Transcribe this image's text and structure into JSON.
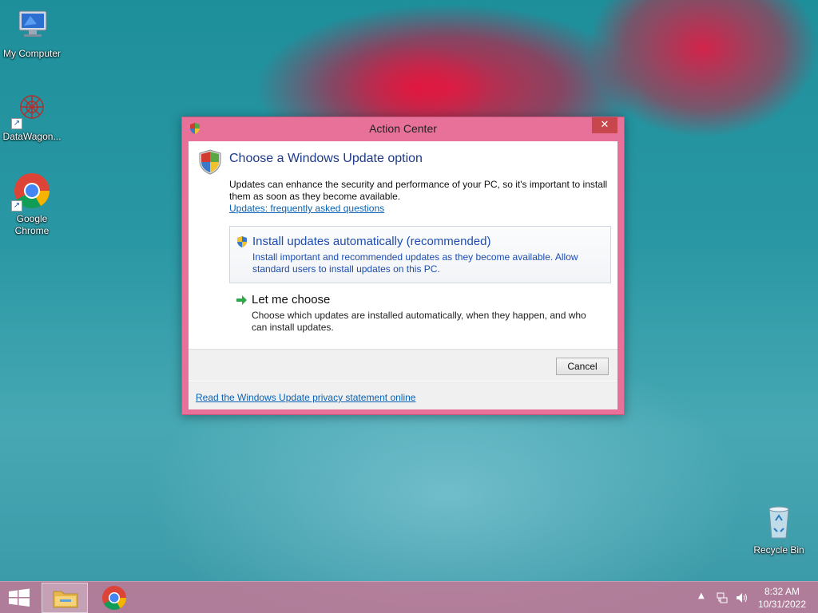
{
  "desktop": {
    "icons": [
      {
        "label": "My Computer"
      },
      {
        "label": "DataWagon..."
      },
      {
        "label": "Google Chrome"
      },
      {
        "label": "Recycle Bin"
      }
    ]
  },
  "dialog": {
    "title": "Action Center",
    "close_label": "✕",
    "heading": "Choose a Windows Update option",
    "description": "Updates can enhance the security and performance of your PC, so it's important to install them as soon as they become available.",
    "faq_link": "Updates: frequently asked questions",
    "options": [
      {
        "title": "Install updates automatically (recommended)",
        "description": "Install important and recommended updates as they become available. Allow standard users to install updates on this PC.",
        "icon": "shield-icon"
      },
      {
        "title": "Let me choose",
        "description": "Choose which updates are installed automatically, when they happen, and who can install updates.",
        "icon": "green-arrow-icon"
      }
    ],
    "cancel_label": "Cancel",
    "privacy_link": "Read the Windows Update privacy statement online"
  },
  "taskbar": {
    "clock_time": "8:32 AM",
    "clock_date": "10/31/2022",
    "tray_arrow": "▲"
  },
  "colors": {
    "dialog_frame": "#e8719a",
    "close_button": "#c7474d",
    "link": "#0a62b5",
    "heading": "#1e3a8a"
  }
}
